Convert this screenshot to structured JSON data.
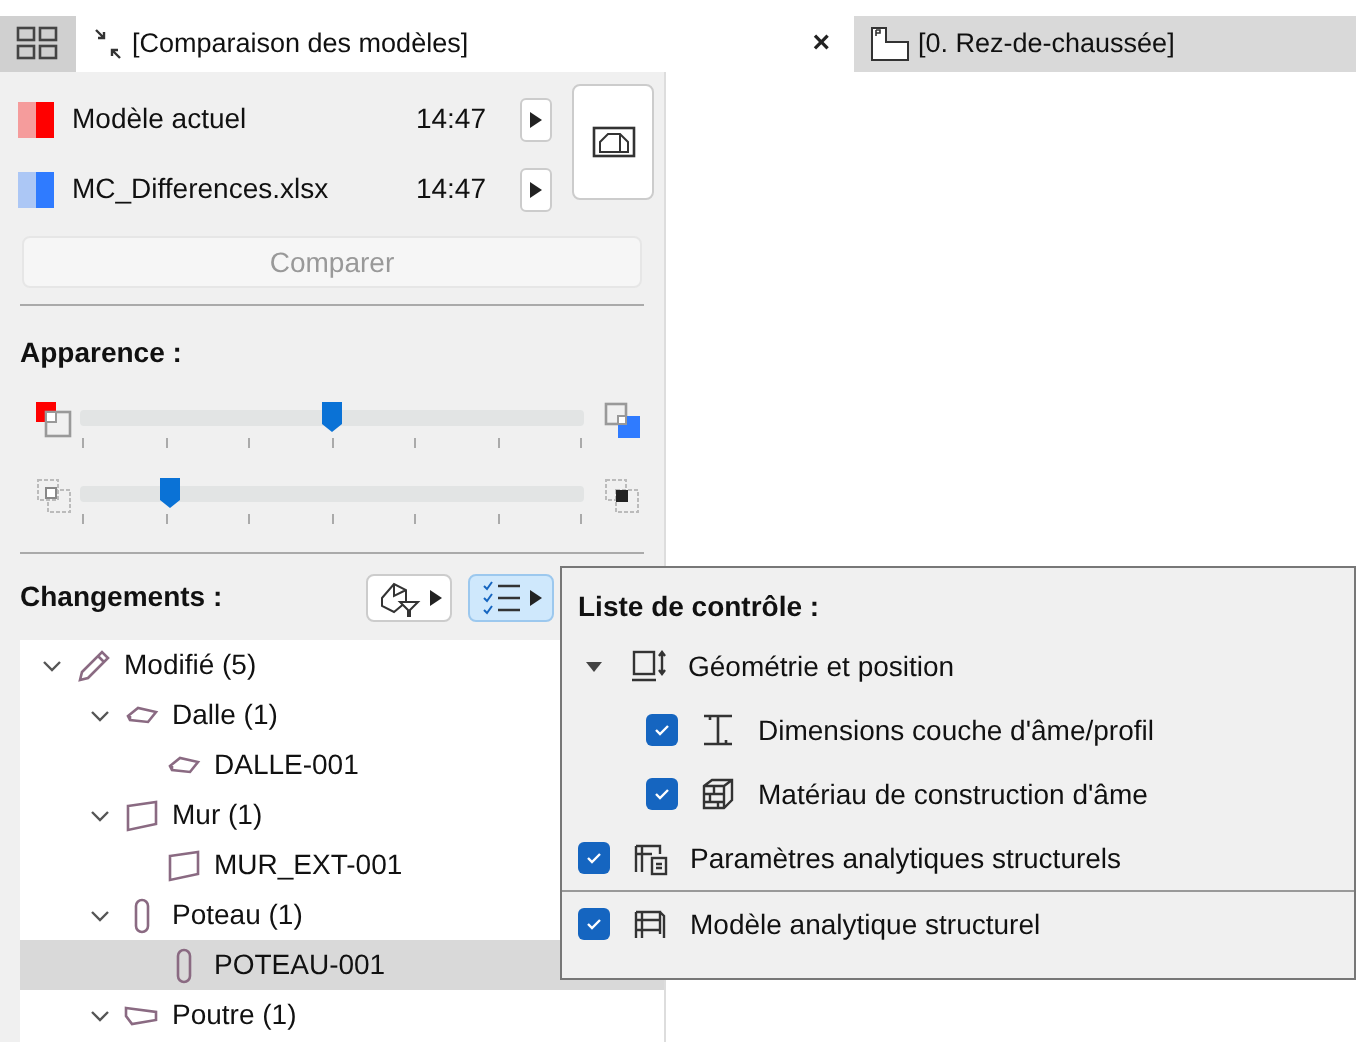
{
  "tabs": [
    {
      "label": "[Comparaison des modèles]",
      "selected": true,
      "close": "×"
    },
    {
      "label": "[0. Rez-de-chaussée]",
      "selected": false
    }
  ],
  "models": [
    {
      "name": "Modèle actuel",
      "time": "14:47",
      "color": "#ff0000"
    },
    {
      "name": "MC_Differences.xlsx",
      "time": "14:47",
      "color": "#2f7bff"
    }
  ],
  "compare_button": {
    "label": "Comparer",
    "disabled": true
  },
  "appearance": {
    "title": "Apparence :",
    "sliders": [
      {
        "kind": "color",
        "level": 0.5
      },
      {
        "kind": "contour",
        "level": 0.18
      }
    ]
  },
  "changes": {
    "title": "Changements :",
    "filter_open": false,
    "checklist_open": true
  },
  "tree": [
    {
      "label": "Modifié (5)",
      "kind": "modified",
      "expanded": true,
      "selected": false,
      "children": [
        {
          "label": "Dalle (1)",
          "kind": "slab",
          "expanded": true,
          "selected": false,
          "children": [
            {
              "label": "DALLE-001",
              "kind": "slab",
              "selected": false
            }
          ]
        },
        {
          "label": "Mur (1)",
          "kind": "wall",
          "expanded": true,
          "selected": false,
          "children": [
            {
              "label": "MUR_EXT-001",
              "kind": "wall",
              "selected": false
            }
          ]
        },
        {
          "label": "Poteau (1)",
          "kind": "column",
          "expanded": true,
          "selected": false,
          "children": [
            {
              "label": "POTEAU-001",
              "kind": "column",
              "selected": true
            }
          ]
        },
        {
          "label": "Poutre (1)",
          "kind": "beam",
          "expanded": true,
          "selected": false
        }
      ]
    }
  ],
  "checklist": {
    "title": "Liste de contrôle :",
    "sections": [
      [
        {
          "label": "Géométrie et position",
          "kind": "group",
          "expanded": true,
          "children": [
            {
              "label": "Dimensions couche d'âme/profil",
              "kind": "check",
              "checked": true
            },
            {
              "label": "Matériau de construction d'âme",
              "kind": "check",
              "checked": true
            }
          ]
        },
        {
          "label": "Paramètres analytiques structurels",
          "kind": "check",
          "checked": true
        }
      ],
      [
        {
          "label": "Modèle analytique structurel",
          "kind": "check",
          "checked": true
        }
      ]
    ]
  }
}
